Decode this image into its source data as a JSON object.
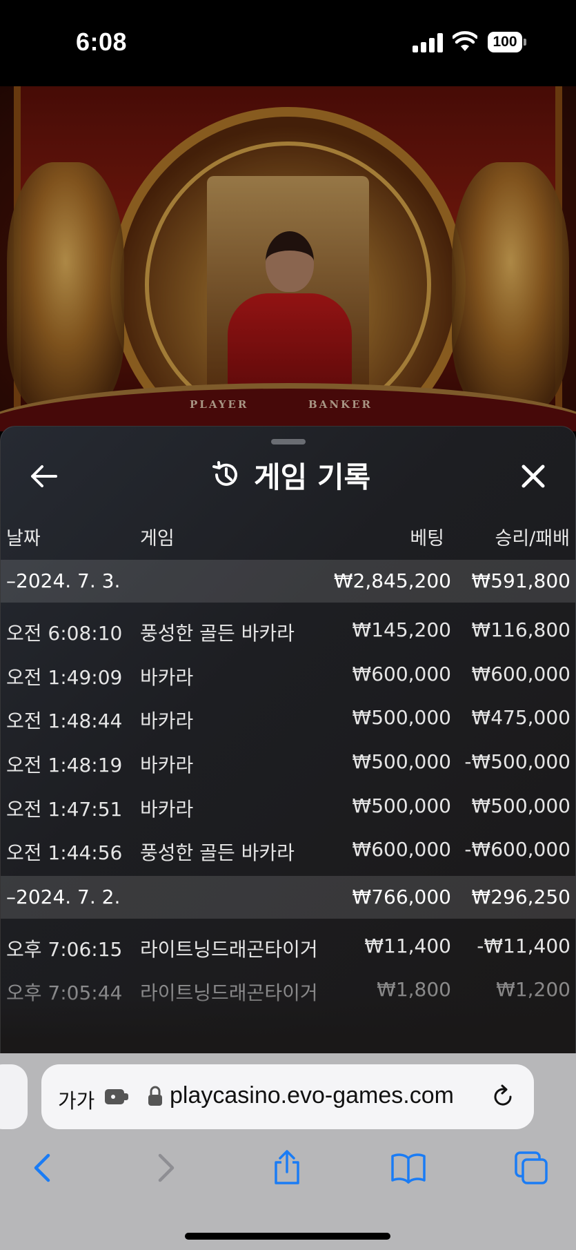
{
  "status_bar": {
    "time": "6:08",
    "battery": "100"
  },
  "video": {
    "table_labels": {
      "player": "PLAYER",
      "banker": "BANKER"
    }
  },
  "panel": {
    "title": "게임 기록",
    "columns": {
      "date": "날짜",
      "game": "게임",
      "bet": "베팅",
      "win_loss": "승리/패배"
    },
    "days": [
      {
        "date": "–2024. 7. 3.",
        "bet_total": "₩2,845,200",
        "win_loss_total": "₩591,800",
        "rows": [
          {
            "time": "오전 6:08:10",
            "game": "풍성한 골든 바카라",
            "bet": "₩145,200",
            "win_loss": "₩116,800"
          },
          {
            "time": "오전 1:49:09",
            "game": "바카라",
            "bet": "₩600,000",
            "win_loss": "₩600,000"
          },
          {
            "time": "오전 1:48:44",
            "game": "바카라",
            "bet": "₩500,000",
            "win_loss": "₩475,000"
          },
          {
            "time": "오전 1:48:19",
            "game": "바카라",
            "bet": "₩500,000",
            "win_loss": "-₩500,000"
          },
          {
            "time": "오전 1:47:51",
            "game": "바카라",
            "bet": "₩500,000",
            "win_loss": "₩500,000"
          },
          {
            "time": "오전 1:44:56",
            "game": "풍성한 골든 바카라",
            "bet": "₩600,000",
            "win_loss": "-₩600,000"
          }
        ]
      },
      {
        "date": "–2024. 7. 2.",
        "bet_total": "₩766,000",
        "win_loss_total": "₩296,250",
        "rows": [
          {
            "time": "오후 7:06:15",
            "game": "라이트닝드래곤타이거",
            "bet": "₩11,400",
            "win_loss": "-₩11,400"
          },
          {
            "time": "오후 7:05:44",
            "game": "라이트닝드래곤타이거",
            "bet": "₩1,800",
            "win_loss": "₩1,200"
          }
        ]
      }
    ]
  },
  "browser": {
    "text_size_label": "가가",
    "url": "playcasino.evo-games.com"
  },
  "icons": {
    "back": "arrow-left-icon",
    "history": "history-clock-icon",
    "close": "close-x-icon",
    "lock": "lock-icon",
    "reload": "reload-icon",
    "extension": "extension-icon",
    "nav_back": "chevron-left-icon",
    "nav_forward": "chevron-right-icon",
    "share": "share-icon",
    "bookmarks": "book-icon",
    "tabs": "tabs-icon"
  },
  "colors": {
    "panel_bg": "#1d1e22",
    "day_row_bg": "#3a3b3e",
    "ios_blue": "#1a7cf5",
    "chrome_bg": "#b7b7b9"
  }
}
